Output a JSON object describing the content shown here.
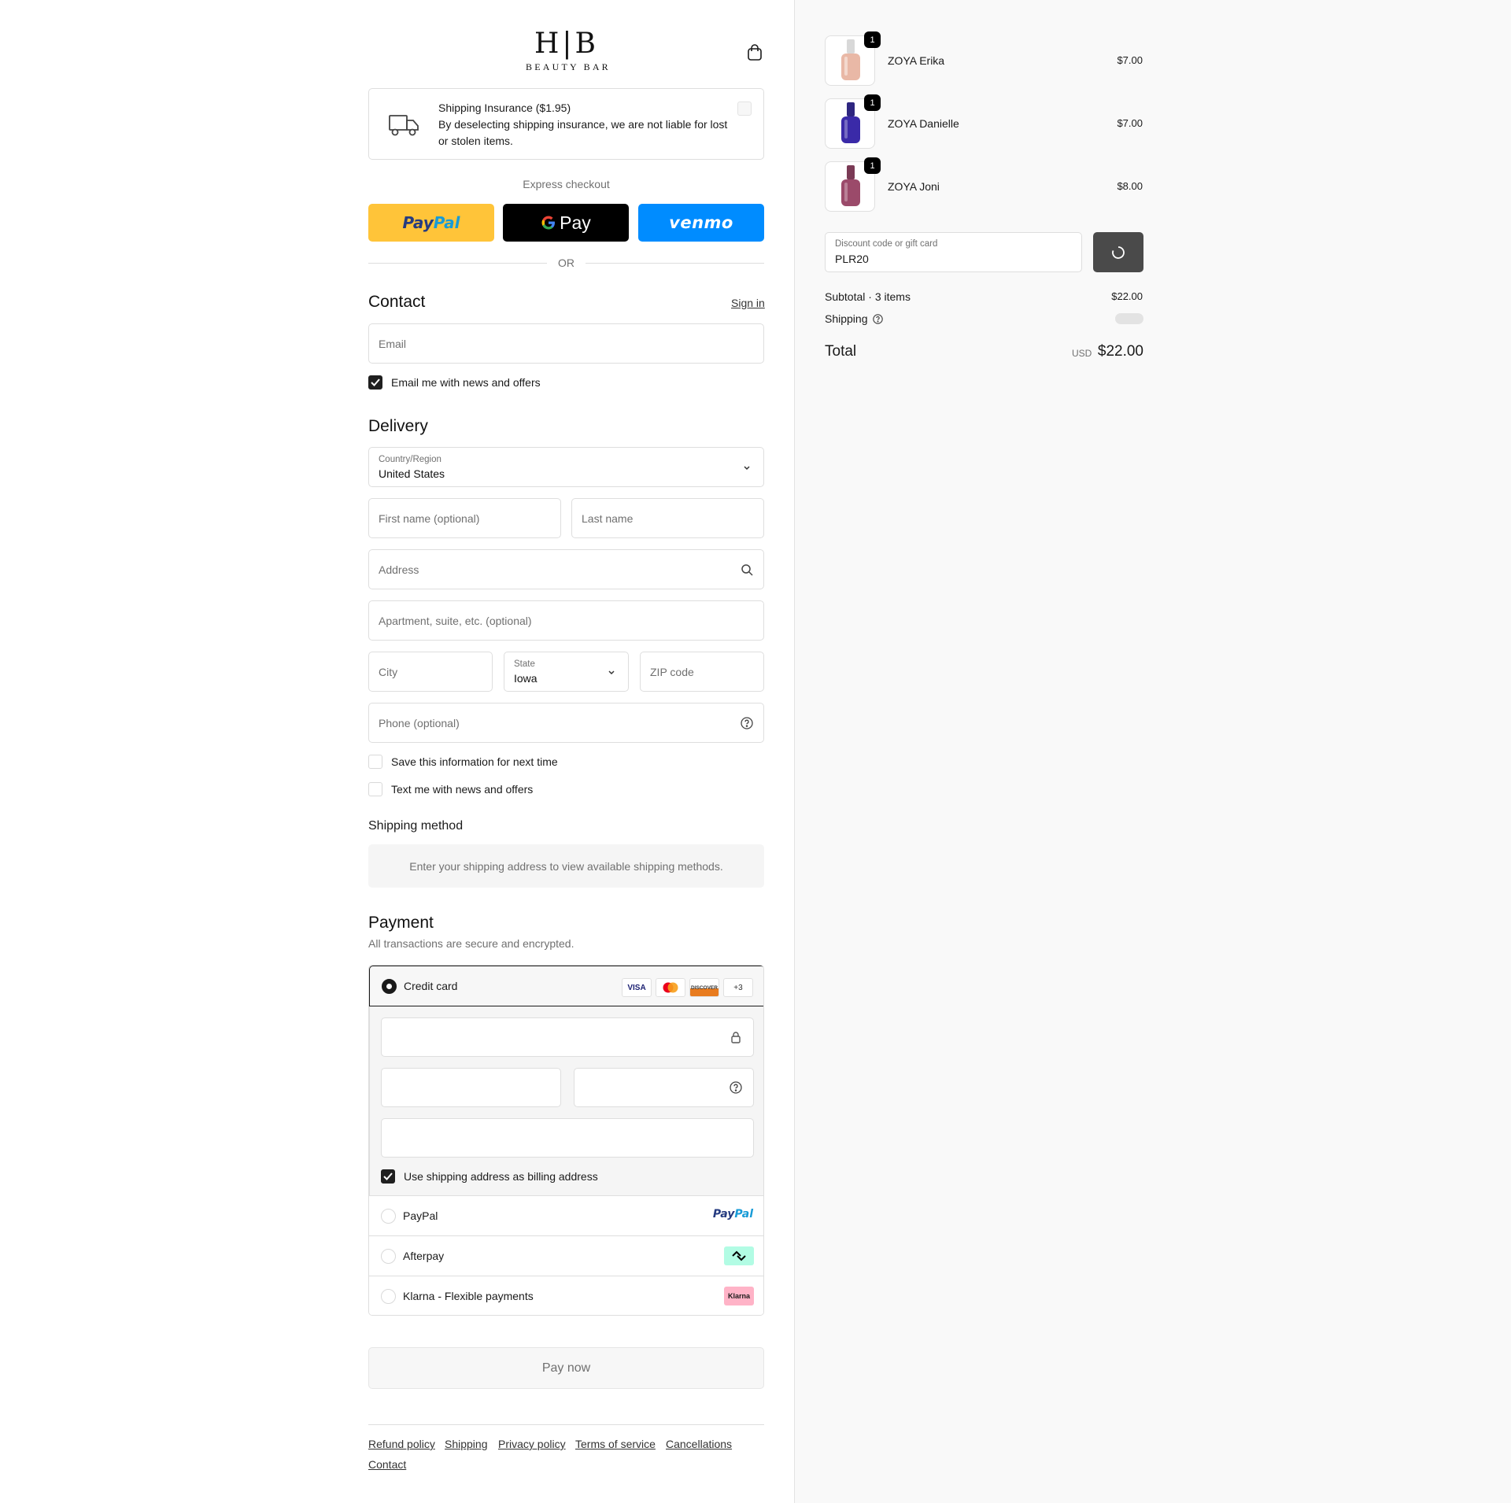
{
  "brand": {
    "mark": "H|B",
    "sub": "BEAUTY BAR"
  },
  "insurance": {
    "title": "Shipping Insurance ($1.95)",
    "description": "By deselecting shipping insurance, we are not liable for lost or stolen items."
  },
  "express": {
    "label": "Express checkout",
    "paypal_a": "Pay",
    "paypal_b": "Pal",
    "gpay": "Pay",
    "venmo": "venmo",
    "or": "OR"
  },
  "contact": {
    "title": "Contact",
    "signin": "Sign in",
    "email_placeholder": "Email",
    "email_offers": "Email me with news and offers"
  },
  "delivery": {
    "title": "Delivery",
    "country_label": "Country/Region",
    "country_value": "United States",
    "first_name": "First name (optional)",
    "last_name": "Last name",
    "address": "Address",
    "apartment": "Apartment, suite, etc. (optional)",
    "city": "City",
    "state_label": "State",
    "state_value": "Iowa",
    "zip": "ZIP code",
    "phone": "Phone (optional)",
    "save_info": "Save this information for next time",
    "text_offers": "Text me with news and offers"
  },
  "shipping_method": {
    "title": "Shipping method",
    "note": "Enter your shipping address to view available shipping methods."
  },
  "payment": {
    "title": "Payment",
    "subtitle": "All transactions are secure and encrypted.",
    "credit_card": "Credit card",
    "card_logos": [
      "VISA",
      "",
      "DISCOVER",
      "+3"
    ],
    "billing_same": "Use shipping address as billing address",
    "paypal": "PayPal",
    "afterpay": "Afterpay",
    "klarna": "Klarna - Flexible payments",
    "klarna_badge": "Klarna",
    "paypal_logo_a": "Pay",
    "paypal_logo_b": "Pal"
  },
  "pay_now": "Pay now",
  "footer": [
    "Refund policy",
    "Shipping",
    "Privacy policy",
    "Terms of service",
    "Cancellations",
    "Contact"
  ],
  "order": {
    "items": [
      {
        "name": "ZOYA Erika",
        "price": "$7.00",
        "qty": "1",
        "color": "#e9b8a6"
      },
      {
        "name": "ZOYA Danielle",
        "price": "$7.00",
        "qty": "1",
        "color": "#3a2aa8"
      },
      {
        "name": "ZOYA Joni",
        "price": "$8.00",
        "qty": "1",
        "color": "#9b4a6a"
      }
    ],
    "discount_label": "Discount code or gift card",
    "discount_value": "PLR20",
    "subtotal_label": "Subtotal · 3 items",
    "subtotal_value": "$22.00",
    "shipping_label": "Shipping",
    "total_label": "Total",
    "currency": "USD",
    "total_value": "$22.00"
  },
  "colors": {
    "paypal_yellow": "#ffc439",
    "venmo_blue": "#008cff",
    "afterpay_mint": "#b2fce4",
    "klarna_pink": "#ffb3c7"
  }
}
